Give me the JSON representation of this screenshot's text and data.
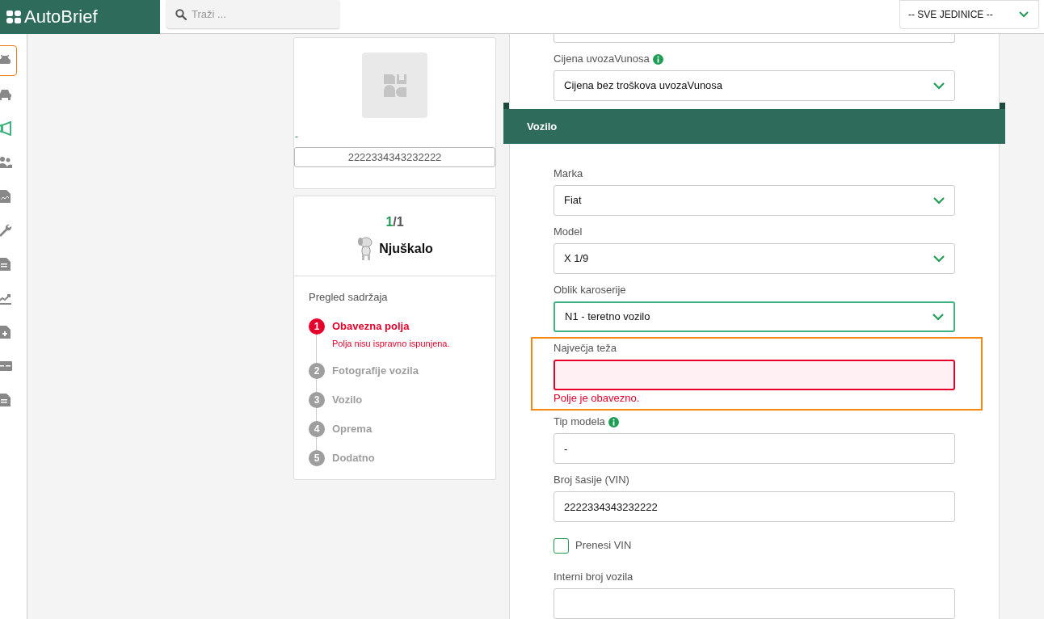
{
  "header": {
    "logo": "AutoBrief",
    "search": {
      "placeholder": "Traži ..."
    },
    "unit_select": {
      "value": "-- SVE JEDINICE --"
    }
  },
  "sidebar": {
    "items": [
      {
        "selected": true,
        "highlighted": false
      },
      {
        "selected": false,
        "highlighted": false
      },
      {
        "selected": false,
        "highlighted": true
      },
      {
        "selected": false,
        "highlighted": false
      },
      {
        "selected": false,
        "highlighted": false
      },
      {
        "selected": false,
        "highlighted": false
      },
      {
        "selected": false,
        "highlighted": false
      },
      {
        "selected": false,
        "highlighted": false
      },
      {
        "selected": false,
        "highlighted": false
      },
      {
        "selected": false,
        "highlighted": false
      },
      {
        "selected": false,
        "highlighted": false
      }
    ]
  },
  "summary_card": {
    "link_text": "-",
    "vin": "2222334343232222"
  },
  "progress_card": {
    "current": "1",
    "total": "/1",
    "portal": "Njuškalo",
    "overview_title": "Pregled sadržaja",
    "steps": [
      {
        "number": "1",
        "label": "Obavezna polja",
        "error": true,
        "message": "Polja nisu ispravno ispunjena."
      },
      {
        "number": "2",
        "label": "Fotografije vozila",
        "error": false
      },
      {
        "number": "3",
        "label": "Vozilo",
        "error": false
      },
      {
        "number": "4",
        "label": "Oprema",
        "error": false
      },
      {
        "number": "5",
        "label": "Dodatno",
        "error": false
      }
    ]
  },
  "form": {
    "items": [
      {
        "kind": "input"
      },
      {
        "kind": "select",
        "label": "Cijena uvozaVunosa",
        "info": true,
        "value": "Cijena bez troškova uvozaVunosa"
      },
      {
        "kind": "section",
        "title": "Vozilo"
      },
      {
        "kind": "select",
        "label": "Marka",
        "value": "Fiat"
      },
      {
        "kind": "select",
        "label": "Model",
        "value": "X 1/9"
      },
      {
        "kind": "select",
        "label": "Oblik karoserije",
        "value": "N1 - teretno vozilo",
        "focused": true
      },
      {
        "kind": "input",
        "label": "Največja teža",
        "invalid": true,
        "error": "Polje je obavezno.",
        "highlighted": true
      },
      {
        "kind": "input",
        "label": "Tip modela",
        "info": true,
        "value": "-"
      },
      {
        "kind": "input",
        "label": "Broj šasije (VIN)",
        "value": "2222334343232222"
      },
      {
        "kind": "checkbox",
        "label": "Prenesi VIN",
        "checked": false
      },
      {
        "kind": "input",
        "label": "Interni broj vozila"
      }
    ]
  }
}
